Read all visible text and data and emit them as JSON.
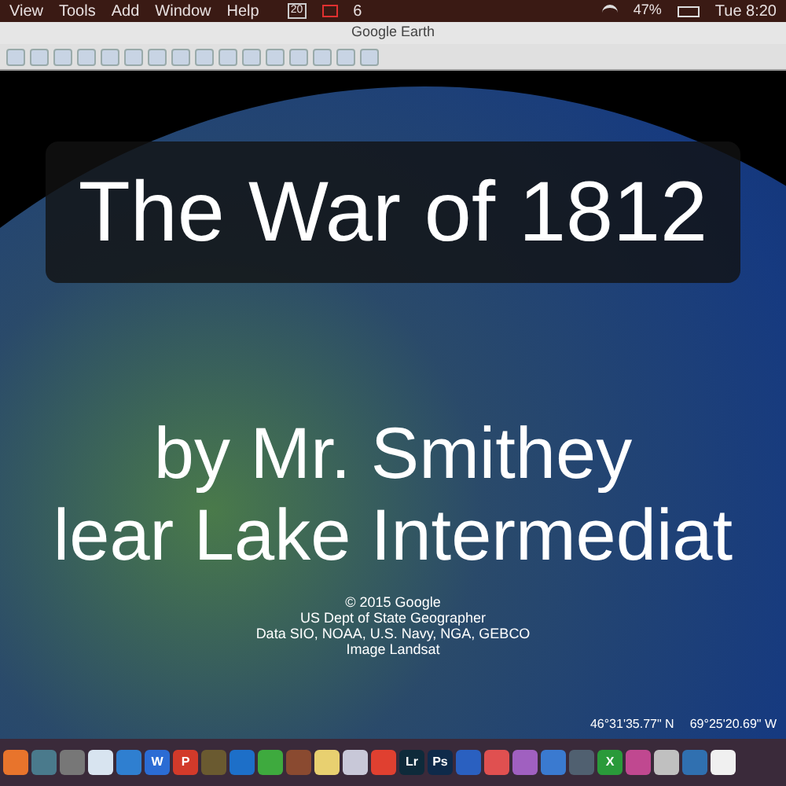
{
  "menu_bar": {
    "menus": [
      "View",
      "Tools",
      "Add",
      "Window",
      "Help"
    ],
    "calendar_day": "20",
    "mail_count": "6",
    "battery": "47%",
    "clock": "Tue 8:20"
  },
  "window": {
    "title": "Google Earth"
  },
  "slide": {
    "title": "The War of 1812",
    "lines": [
      "by Mr. Smithey",
      "lear Lake Intermediat"
    ]
  },
  "attribution": [
    "© 2015 Google",
    "US Dept of State Geographer",
    "Data SIO, NOAA, U.S. Navy, NGA, GEBCO",
    "Image Landsat"
  ],
  "coordinates": [
    "46°31'35.77\" N",
    "69°25'20.69\" W"
  ],
  "dock": [
    {
      "color": "#e8742c"
    },
    {
      "color": "#4a7a8c"
    },
    {
      "color": "#777777"
    },
    {
      "color": "#d8e4f0"
    },
    {
      "color": "#2f7fd0"
    },
    {
      "color": "#2b6cd4",
      "label": "W"
    },
    {
      "color": "#d23a2a",
      "label": "P"
    },
    {
      "color": "#6a5a30"
    },
    {
      "color": "#1d6fc8"
    },
    {
      "color": "#3eaa3e"
    },
    {
      "color": "#8a4a30"
    },
    {
      "color": "#e8d070"
    },
    {
      "color": "#c8c8d8"
    },
    {
      "color": "#e04030"
    },
    {
      "color": "#0e2a3a",
      "label": "Lr"
    },
    {
      "color": "#0e2a4a",
      "label": "Ps"
    },
    {
      "color": "#2a60c0"
    },
    {
      "color": "#e05050"
    },
    {
      "color": "#a060c0"
    },
    {
      "color": "#3a7ad0"
    },
    {
      "color": "#506070"
    },
    {
      "color": "#2a9a3a",
      "label": "X"
    },
    {
      "color": "#c04890"
    },
    {
      "color": "#c0c0c0"
    },
    {
      "color": "#3070b0"
    },
    {
      "color": "#f0f0f0"
    }
  ]
}
